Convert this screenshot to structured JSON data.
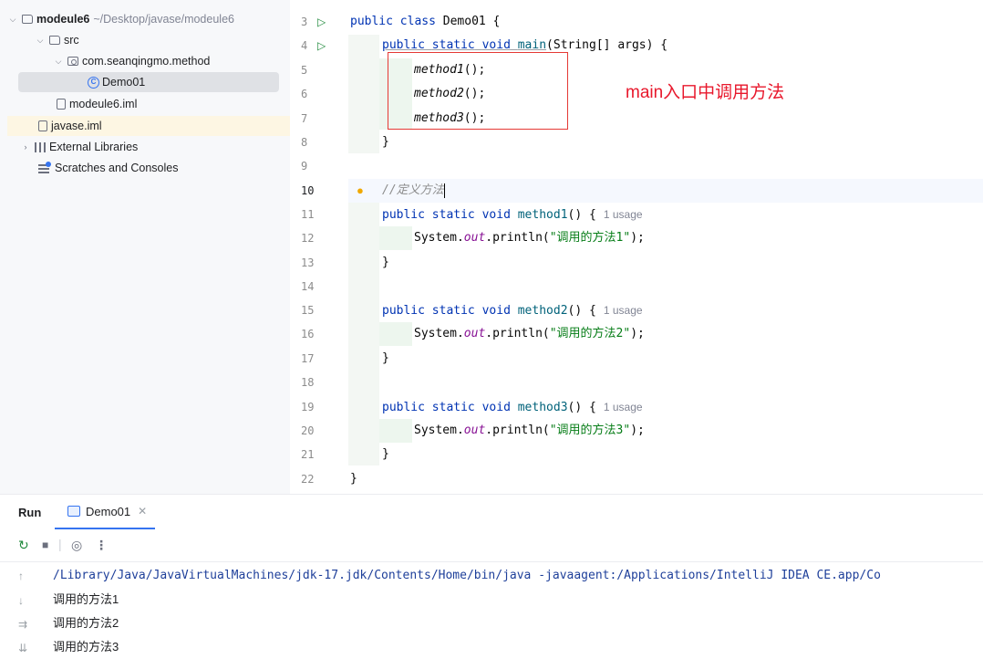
{
  "project_tree": {
    "module_name": "modeule6",
    "module_path": "~/Desktop/javase/modeule6",
    "src_label": "src",
    "package_label": "com.seanqingmo.method",
    "class_label": "Demo01",
    "module_iml_label": "modeule6.iml",
    "javase_iml_label": "javase.iml",
    "external_libraries_label": "External Libraries",
    "scratches_label": "Scratches and Consoles"
  },
  "editor": {
    "line_numbers": [
      "3",
      "4",
      "5",
      "6",
      "7",
      "8",
      "9",
      "10",
      "11",
      "12",
      "13",
      "14",
      "15",
      "16",
      "17",
      "18",
      "19",
      "20",
      "21",
      "22"
    ],
    "kw_public": "public",
    "kw_class": "class",
    "kw_static": "static",
    "kw_void": "void",
    "class_decl_rest": " Demo01 {",
    "main_name": "main",
    "main_params": "(String[] args) {",
    "call1": "method1",
    "call2": "method2",
    "call3": "method3",
    "call_suffix": "();",
    "close_brace": "}",
    "comment": "//定义方法",
    "method1_name": "method1",
    "method2_name": "method2",
    "method3_name": "method3",
    "method_decl_suffix": "() {",
    "usage_hint": "1 usage",
    "system_prefix": "System.",
    "out_field": "out",
    "println_prefix": ".println(",
    "string1": "\"调用的方法1\"",
    "string2": "\"调用的方法2\"",
    "string3": "\"调用的方法3\"",
    "println_suffix": ");",
    "annotation_note": "main入口中调用方法",
    "annotation_color": "#e8182c"
  },
  "run_panel": {
    "title": "Run",
    "tab_label": "Demo01",
    "command_line": "/Library/Java/JavaVirtualMachines/jdk-17.jdk/Contents/Home/bin/java -javaagent:/Applications/IntelliJ IDEA CE.app/Co",
    "output_lines": [
      "调用的方法1",
      "调用的方法2",
      "调用的方法3"
    ]
  },
  "colors": {
    "keyword": "#0033b3",
    "method_decl": "#00627a",
    "string": "#067d17",
    "field": "#871094",
    "accent": "#3574f0"
  }
}
